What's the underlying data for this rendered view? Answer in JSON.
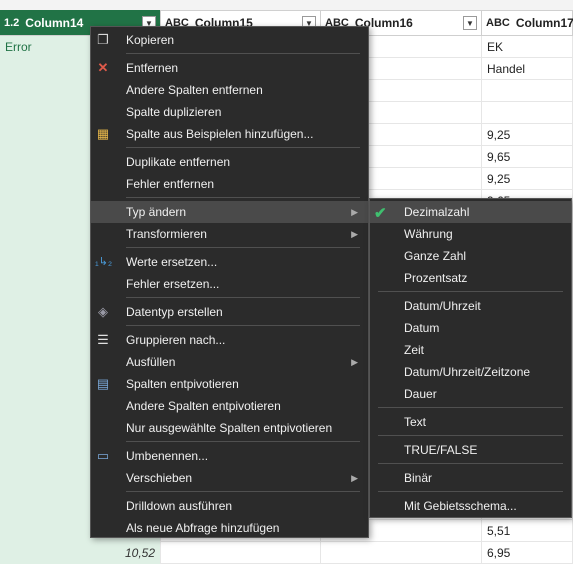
{
  "columns": [
    {
      "type": "1.2",
      "name": "Column14"
    },
    {
      "type": "ABC",
      "name": "Column15"
    },
    {
      "type": "ABC",
      "name": "Column16"
    },
    {
      "type": "ABC",
      "name": "Column17"
    }
  ],
  "rows": [
    {
      "c14": "Error",
      "c17": "EK"
    },
    {
      "c14": "",
      "c17": "Handel"
    },
    {
      "c14": "",
      "c17": ""
    },
    {
      "c14": "",
      "c17": ""
    },
    {
      "c14": "",
      "c17": "9,25"
    },
    {
      "c14": "",
      "c17": "9,65"
    },
    {
      "c14": "",
      "c17": "9,25"
    },
    {
      "c14": "",
      "c17": "9,65"
    },
    {
      "c14": "",
      "c17": ""
    },
    {
      "c14": "",
      "c17": ""
    },
    {
      "c14": "",
      "c17": ""
    },
    {
      "c14": "",
      "c17": ""
    },
    {
      "c14": "",
      "c17": ""
    },
    {
      "c14": "",
      "c17": ""
    },
    {
      "c14": "",
      "c17": ""
    },
    {
      "c14": "",
      "c17": ""
    },
    {
      "c14": "",
      "c17": ""
    },
    {
      "c14": "",
      "c17": ""
    },
    {
      "c14": "",
      "c17": ""
    },
    {
      "c14": "",
      "c17": ""
    },
    {
      "c14": "",
      "c17": ""
    },
    {
      "c14": "",
      "c17": ""
    },
    {
      "c14": "",
      "c17": "5,51"
    },
    {
      "c14": "10,52",
      "c17": "6,95"
    }
  ],
  "context_menu": {
    "copy": "Kopieren",
    "remove_columns": "Entfernen",
    "remove_other_columns": "Andere Spalten entfernen",
    "duplicate_column": "Spalte duplizieren",
    "add_column_from_examples": "Spalte aus Beispielen hinzufügen...",
    "remove_duplicates": "Duplikate entfernen",
    "remove_errors": "Fehler entfernen",
    "change_type": "Typ ändern",
    "transform": "Transformieren",
    "replace_values": "Werte ersetzen...",
    "replace_errors": "Fehler ersetzen...",
    "create_data_type": "Datentyp erstellen",
    "group_by": "Gruppieren nach...",
    "fill": "Ausfüllen",
    "unpivot_columns": "Spalten entpivotieren",
    "unpivot_other_columns": "Andere Spalten entpivotieren",
    "unpivot_selected_columns": "Nur ausgewählte Spalten entpivotieren",
    "rename": "Umbenennen...",
    "move": "Verschieben",
    "drilldown": "Drilldown ausführen",
    "add_as_new_query": "Als neue Abfrage hinzufügen"
  },
  "type_submenu": {
    "decimal": "Dezimalzahl",
    "currency": "Währung",
    "whole_number": "Ganze Zahl",
    "percentage": "Prozentsatz",
    "datetime": "Datum/Uhrzeit",
    "date": "Datum",
    "time": "Zeit",
    "datetimezone": "Datum/Uhrzeit/Zeitzone",
    "duration": "Dauer",
    "text": "Text",
    "boolean": "TRUE/FALSE",
    "binary": "Binär",
    "using_locale": "Mit Gebietsschema...",
    "selected": "Dezimalzahl"
  },
  "colors": {
    "selected_header": "#217346",
    "menu_background": "#2b2b2b",
    "checkmark": "#3fbf6f"
  },
  "icons": [
    "copy-icon",
    "remove-icon",
    "add-column-icon",
    "replace-values-icon",
    "data-type-icon",
    "group-by-icon",
    "unpivot-icon",
    "rename-icon",
    "submenu-arrow-icon",
    "check-icon",
    "filter-dropdown-icon"
  ]
}
